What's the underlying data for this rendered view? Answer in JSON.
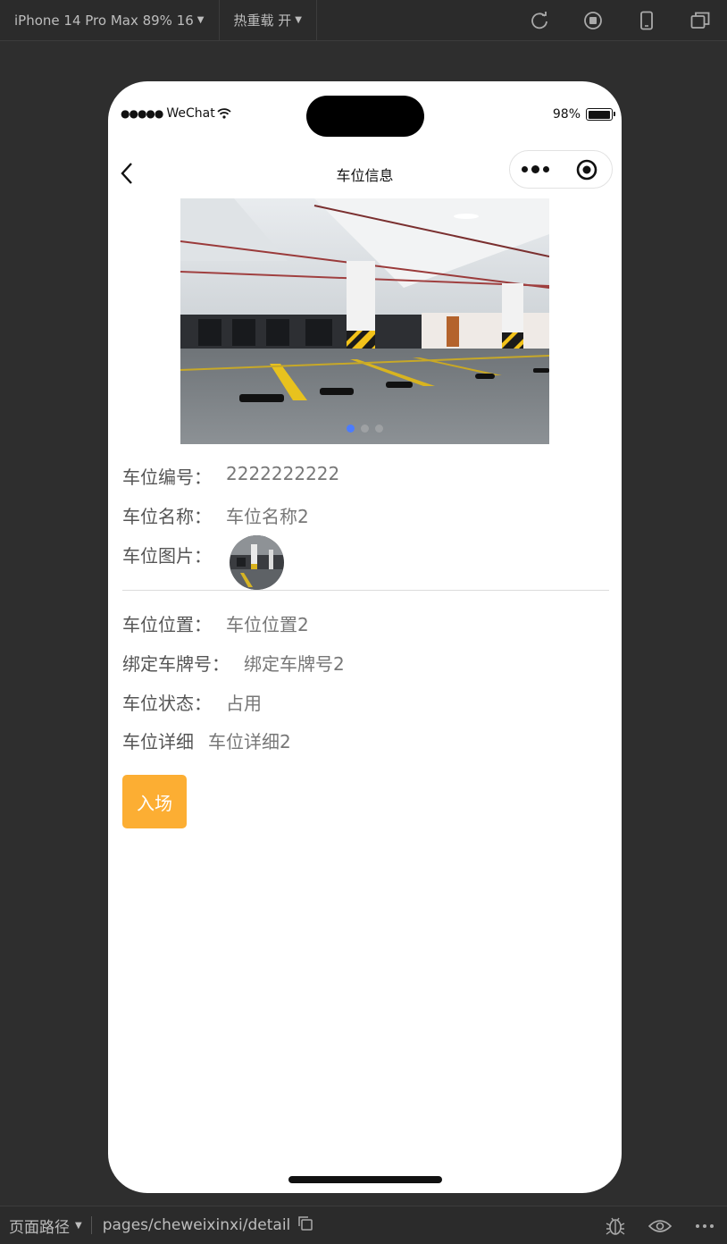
{
  "toolbar": {
    "device_label": "iPhone 14 Pro Max 89% 16",
    "hot_reload_label": "热重载 开"
  },
  "status": {
    "carrier": "WeChat",
    "battery": "98%",
    "battery_level": 0.98
  },
  "nav": {
    "title": "车位信息"
  },
  "banner": {
    "slides": 3,
    "active_index": 0
  },
  "detail": {
    "code_label": "车位编号：",
    "code_value": "2222222222",
    "name_label": "车位名称：",
    "name_value": "车位名称2",
    "image_label": "车位图片：",
    "location_label": "车位位置：",
    "location_value": "车位位置2",
    "plate_label": "绑定车牌号：",
    "plate_value": "绑定车牌号2",
    "state_label": "车位状态：",
    "state_value": "占用",
    "info_label": "车位详细",
    "info_value": "车位详细2"
  },
  "actions": {
    "enter_label": "入场"
  },
  "bottombar": {
    "path_label": "页面路径",
    "path": "pages/cheweixinxi/detail"
  },
  "colors": {
    "accent_button": "#fcae33",
    "indicator_active": "#4c7cff"
  }
}
